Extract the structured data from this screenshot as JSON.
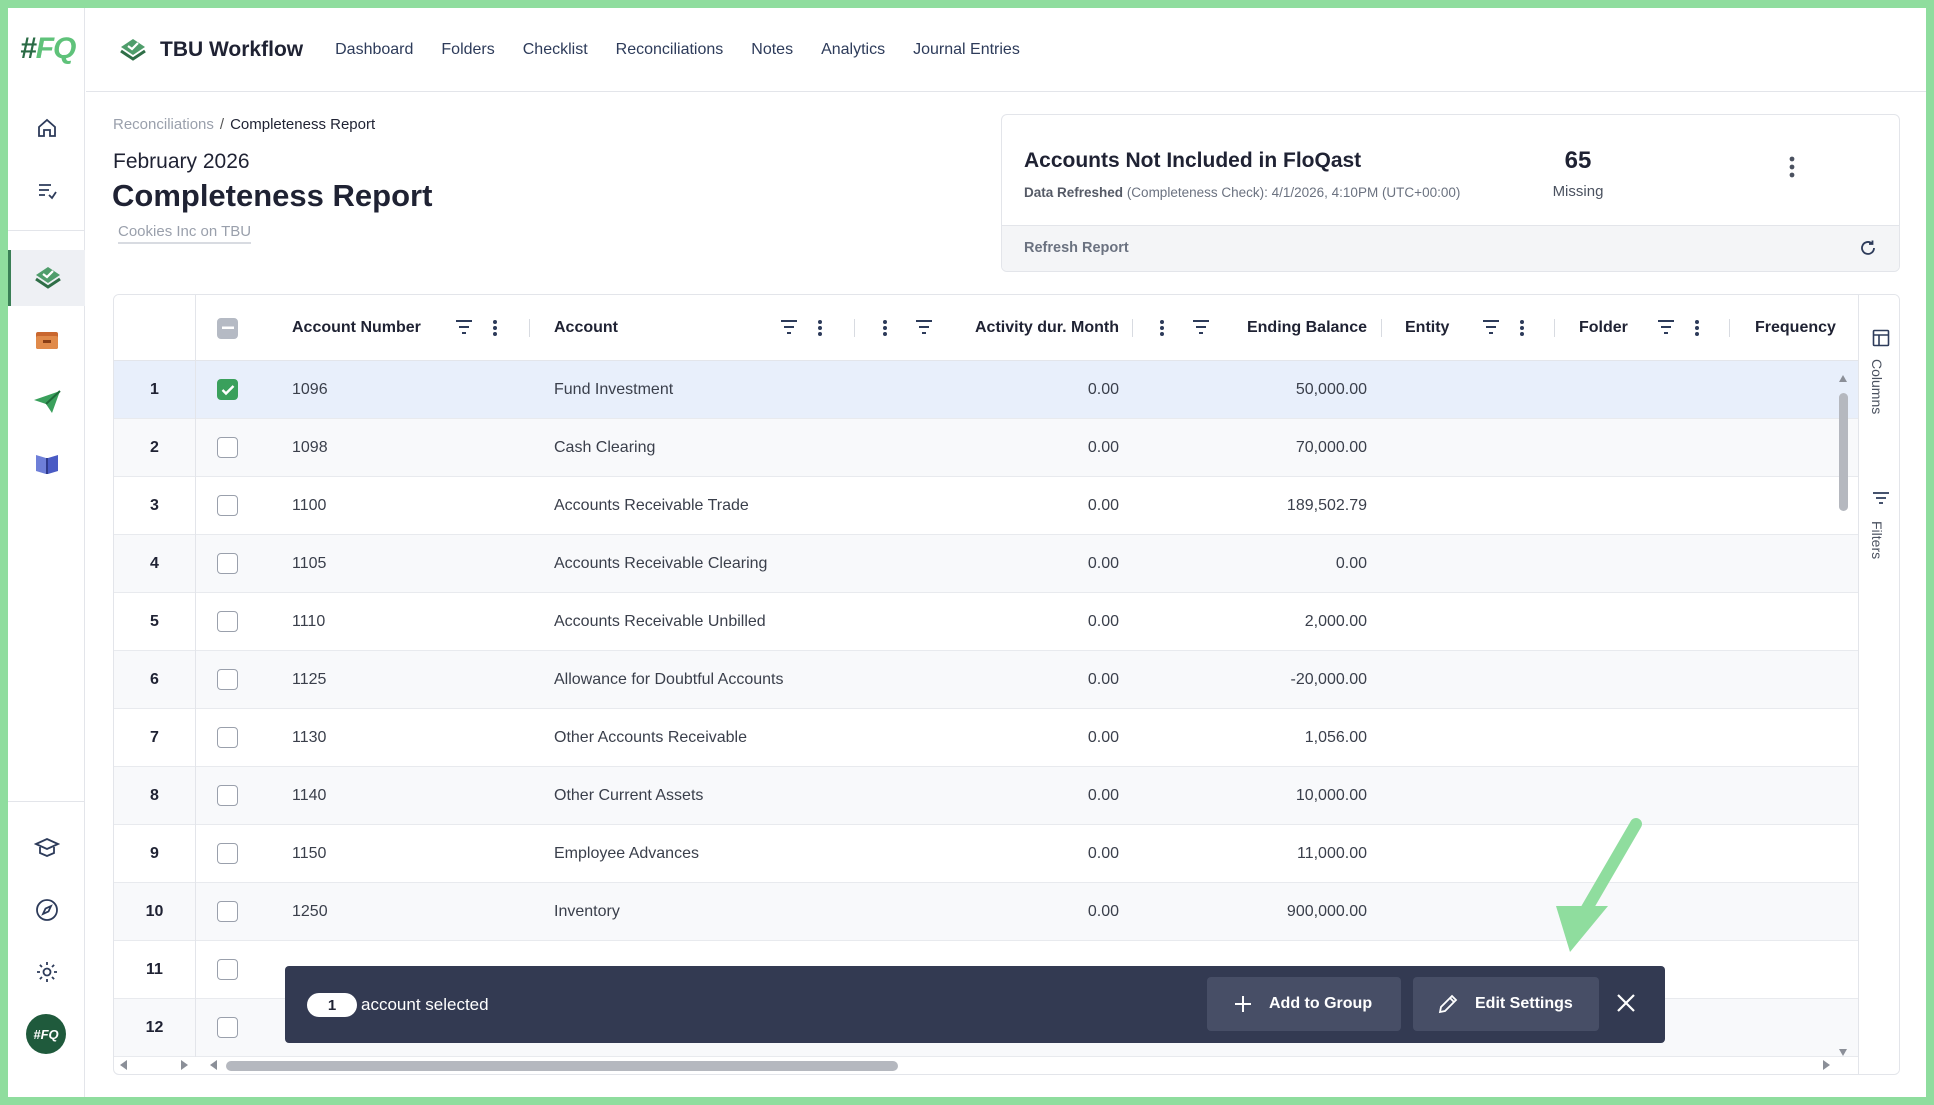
{
  "app": {
    "logo_text": "#FQ",
    "brand_title": "TBU Workflow",
    "avatar_text": "#FQ"
  },
  "nav": {
    "items": [
      "Dashboard",
      "Folders",
      "Checklist",
      "Reconciliations",
      "Notes",
      "Analytics",
      "Journal Entries"
    ]
  },
  "rail": {
    "icons": [
      "home-icon",
      "checklist-icon",
      "workflow-icon",
      "folders-icon",
      "send-icon",
      "library-icon",
      "learn-icon",
      "compass-icon",
      "gear-icon"
    ]
  },
  "header": {
    "breadcrumb_parent": "Reconciliations",
    "breadcrumb_separator": "/",
    "breadcrumb_current": "Completeness Report",
    "period": "February 2026",
    "title": "Completeness Report",
    "subtitle": "Cookies Inc on TBU"
  },
  "card": {
    "title": "Accounts Not Included in FloQast",
    "refresh_label": "Data Refreshed",
    "refresh_detail": "(Completeness Check): 4/1/2026, 4:10PM (UTC+00:00)",
    "count": "65",
    "count_label": "Missing",
    "refresh_button": "Refresh Report"
  },
  "grid": {
    "columns": [
      "Account Number",
      "Account",
      "Activity dur. Month",
      "Ending Balance",
      "Entity",
      "Folder",
      "Frequency"
    ],
    "side_panel": [
      "Columns",
      "Filters"
    ],
    "rows": [
      {
        "n": "1",
        "checked": true,
        "number": "1096",
        "account": "Fund Investment",
        "activity": "0.00",
        "balance": "50,000.00"
      },
      {
        "n": "2",
        "checked": false,
        "number": "1098",
        "account": "Cash Clearing",
        "activity": "0.00",
        "balance": "70,000.00"
      },
      {
        "n": "3",
        "checked": false,
        "number": "1100",
        "account": "Accounts Receivable Trade",
        "activity": "0.00",
        "balance": "189,502.79"
      },
      {
        "n": "4",
        "checked": false,
        "number": "1105",
        "account": "Accounts Receivable Clearing",
        "activity": "0.00",
        "balance": "0.00"
      },
      {
        "n": "5",
        "checked": false,
        "number": "1110",
        "account": "Accounts Receivable Unbilled",
        "activity": "0.00",
        "balance": "2,000.00"
      },
      {
        "n": "6",
        "checked": false,
        "number": "1125",
        "account": "Allowance for Doubtful Accounts",
        "activity": "0.00",
        "balance": "-20,000.00"
      },
      {
        "n": "7",
        "checked": false,
        "number": "1130",
        "account": "Other Accounts Receivable",
        "activity": "0.00",
        "balance": "1,056.00"
      },
      {
        "n": "8",
        "checked": false,
        "number": "1140",
        "account": "Other Current Assets",
        "activity": "0.00",
        "balance": "10,000.00"
      },
      {
        "n": "9",
        "checked": false,
        "number": "1150",
        "account": "Employee Advances",
        "activity": "0.00",
        "balance": "11,000.00"
      },
      {
        "n": "10",
        "checked": false,
        "number": "1250",
        "account": "Inventory",
        "activity": "0.00",
        "balance": "900,000.00"
      },
      {
        "n": "11",
        "checked": false,
        "number": "",
        "account": "",
        "activity": "",
        "balance": ""
      },
      {
        "n": "12",
        "checked": false,
        "number": "",
        "account": "",
        "activity": "",
        "balance": ""
      }
    ]
  },
  "selection_bar": {
    "count": "1",
    "text": "account selected",
    "add_to_group": "Add to Group",
    "edit_settings": "Edit Settings"
  },
  "colors": {
    "accent_green": "#3aa05c",
    "toolbar_bg": "#333a52",
    "frame_green": "#8fdd9e"
  }
}
